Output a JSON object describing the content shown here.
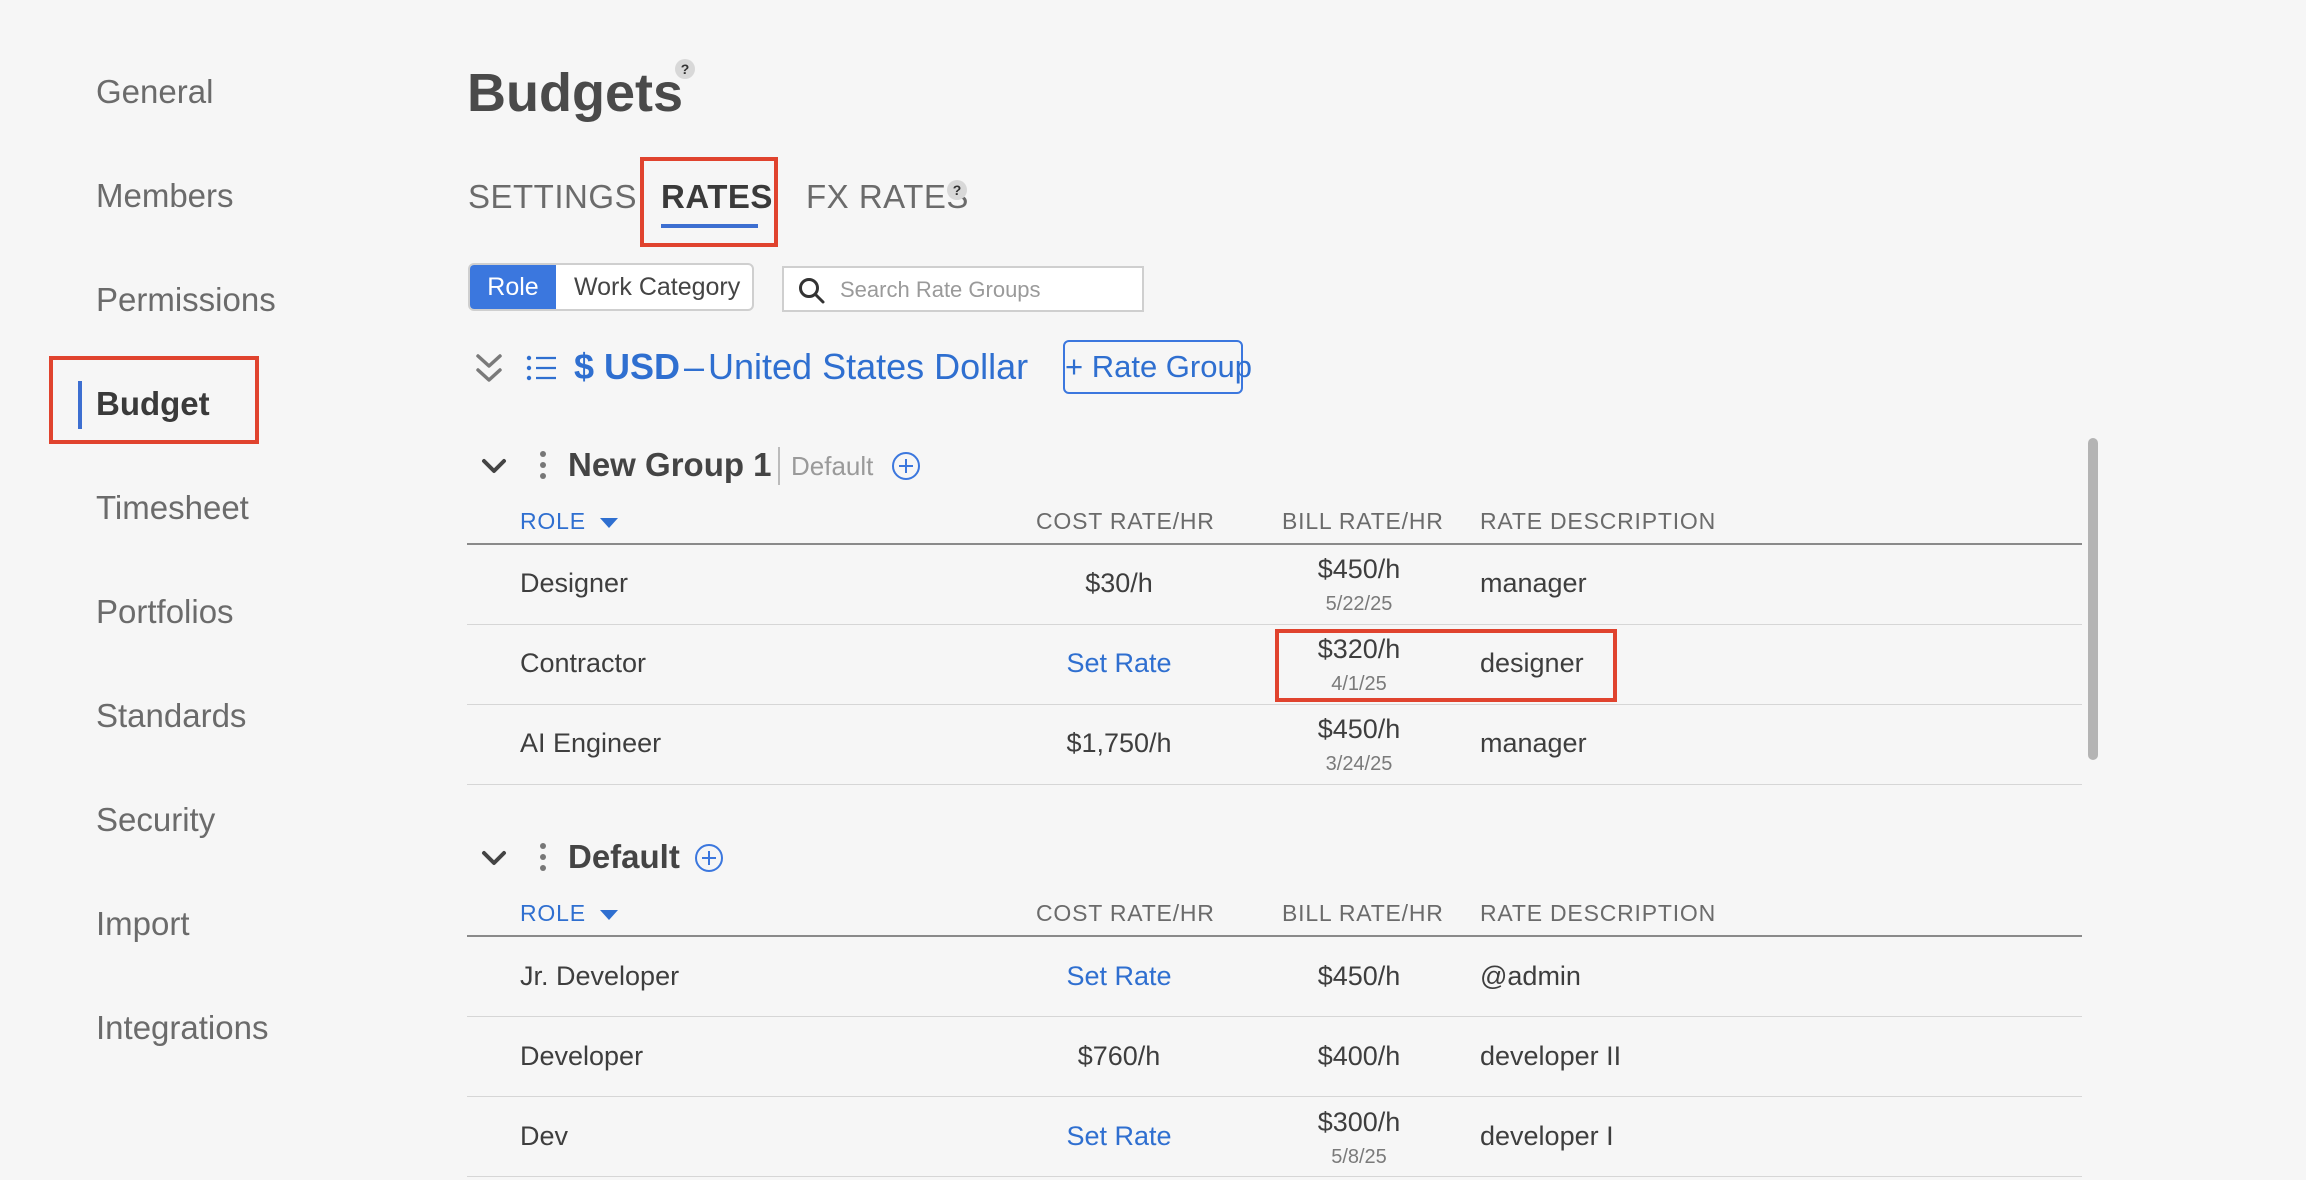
{
  "sidebar": {
    "items": [
      {
        "label": "General"
      },
      {
        "label": "Members"
      },
      {
        "label": "Permissions"
      },
      {
        "label": "Budget"
      },
      {
        "label": "Timesheet"
      },
      {
        "label": "Portfolios"
      },
      {
        "label": "Standards"
      },
      {
        "label": "Security"
      },
      {
        "label": "Import"
      },
      {
        "label": "Integrations"
      }
    ],
    "active": "Budget"
  },
  "page": {
    "title": "Budgets",
    "help": "?"
  },
  "tabs": [
    {
      "label": "SETTINGS"
    },
    {
      "label": "RATES"
    },
    {
      "label": "FX RATES"
    }
  ],
  "active_tab": "RATES",
  "toggle": {
    "role": "Role",
    "work_category": "Work Category"
  },
  "search": {
    "placeholder": "Search Rate Groups"
  },
  "currency": {
    "code": "$ USD",
    "dash": "–",
    "name": "United States Dollar",
    "add_button": "+ Rate Group"
  },
  "columns": {
    "role": "ROLE",
    "cost": "COST RATE/HR",
    "bill": "BILL RATE/HR",
    "desc": "RATE DESCRIPTION"
  },
  "groups": [
    {
      "name": "New Group 1",
      "default_tag": "Default",
      "rows": [
        {
          "role": "Designer",
          "cost": "$30/h",
          "bill": "$450/h",
          "bill_date": "5/22/25",
          "desc": "manager"
        },
        {
          "role": "Contractor",
          "cost": "Set Rate",
          "bill": "$320/h",
          "bill_date": "4/1/25",
          "desc": "designer"
        },
        {
          "role": "AI Engineer",
          "cost": "$1,750/h",
          "bill": "$450/h",
          "bill_date": "3/24/25",
          "desc": "manager"
        }
      ]
    },
    {
      "name": "Default",
      "rows": [
        {
          "role": "Jr. Developer",
          "cost": "Set Rate",
          "bill": "$450/h",
          "bill_date": "",
          "desc": "@admin"
        },
        {
          "role": "Developer",
          "cost": "$760/h",
          "bill": "$400/h",
          "bill_date": "",
          "desc": "developer II"
        },
        {
          "role": "Dev",
          "cost": "Set Rate",
          "bill": "$300/h",
          "bill_date": "5/8/25",
          "desc": "developer I"
        }
      ]
    }
  ],
  "colors": {
    "accent": "#3b77de",
    "highlight": "#e0432e"
  }
}
